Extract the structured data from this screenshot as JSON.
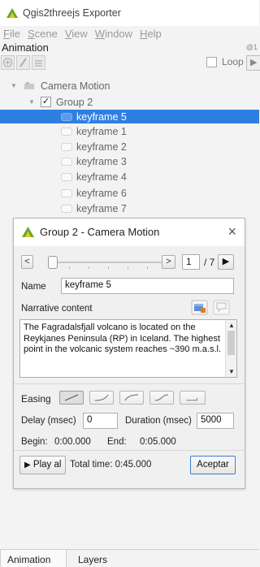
{
  "window": {
    "title": "Qgis2threejs Exporter"
  },
  "menu": [
    {
      "accel": "F",
      "rest": "ile"
    },
    {
      "accel": "S",
      "rest": "cene"
    },
    {
      "accel": "V",
      "rest": "iew"
    },
    {
      "accel": "W",
      "rest": "indow"
    },
    {
      "accel": "H",
      "rest": "elp"
    }
  ],
  "panel": {
    "title": "Animation",
    "corner": "@1"
  },
  "toolbar": {
    "add_icon": "add-keyframe-icon",
    "edit_icon": "edit-icon",
    "remove_icon": "remove-icon",
    "loop_label": "Loop",
    "play_icon": "play-icon"
  },
  "tree": {
    "root": "Camera Motion",
    "group": "Group 2",
    "group_checked": true,
    "keyframes": [
      "keyframe 5",
      "keyframe 1",
      "keyframe 2",
      "keyframe 3",
      "keyframe 4",
      "keyframe 6",
      "keyframe 7"
    ],
    "selected_index": 0
  },
  "dialog": {
    "title": "Group 2 - Camera Motion",
    "close_glyph": "×",
    "prev_glyph": "<",
    "next_glyph": ">",
    "play_glyph": "▶",
    "current_frame": "1",
    "total_frames": "/ 7",
    "name_label": "Name",
    "name_value": "keyframe 5",
    "narrative_label": "Narrative content",
    "narrative_text": "The Fagradalsfjall volcano is located on the Reykjanes Peninsula (RP) in Iceland. The highest point in the volcanic system reaches ~390 m.a.s.l.",
    "easing_label": "Easing",
    "delay_label": "Delay (msec)",
    "delay_value": "0",
    "duration_label": "Duration (msec)",
    "duration_value": "5000",
    "begin_label": "Begin:",
    "begin_value": "0:00.000",
    "end_label": "End:",
    "end_value": "0:05.000",
    "play_all_label": "Play al",
    "total_time_label": "Total time: 0:45.000",
    "accept_label": "Aceptar"
  },
  "tabs": [
    "Animation",
    "Layers"
  ],
  "colors": {
    "selection": "#2f7fe3",
    "logo_green": "#5aa832",
    "logo_yellow": "#f0c419"
  }
}
